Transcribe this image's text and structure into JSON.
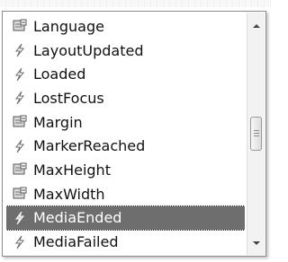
{
  "list": {
    "items": [
      {
        "label": "Language",
        "icon": "property-icon",
        "selected": false
      },
      {
        "label": "LayoutUpdated",
        "icon": "event-icon",
        "selected": false
      },
      {
        "label": "Loaded",
        "icon": "event-icon",
        "selected": false
      },
      {
        "label": "LostFocus",
        "icon": "event-icon",
        "selected": false
      },
      {
        "label": "Margin",
        "icon": "property-icon",
        "selected": false
      },
      {
        "label": "MarkerReached",
        "icon": "event-icon",
        "selected": false
      },
      {
        "label": "MaxHeight",
        "icon": "property-icon",
        "selected": false
      },
      {
        "label": "MaxWidth",
        "icon": "property-icon",
        "selected": false
      },
      {
        "label": "MediaEnded",
        "icon": "event-icon",
        "selected": true
      },
      {
        "label": "MediaFailed",
        "icon": "event-icon",
        "selected": false
      }
    ]
  },
  "scrollbar": {
    "up_icon": "scroll-up-icon",
    "down_icon": "scroll-down-icon",
    "thumb_icon": "scroll-thumb-grip-icon"
  },
  "colors": {
    "selected_bg": "#6e6e6e",
    "selected_text": "#ffffff",
    "text": "#111111",
    "border": "#8c8c8c"
  }
}
